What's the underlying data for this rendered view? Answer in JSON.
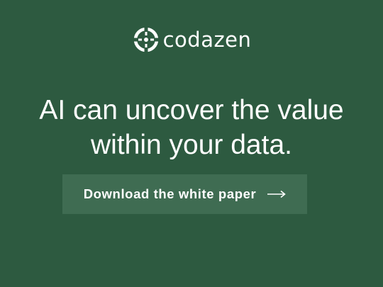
{
  "brand": {
    "name": "codazen",
    "logo_icon": "codazen-logo-mark",
    "text_color": "#ffffff"
  },
  "hero": {
    "headline_line1": "AI can uncover the value",
    "headline_line2": "within your data.",
    "background_color": "#2d5a40"
  },
  "cta": {
    "label": "Download the white paper",
    "icon": "arrow-right-icon",
    "background_color": "#3f6c52"
  }
}
